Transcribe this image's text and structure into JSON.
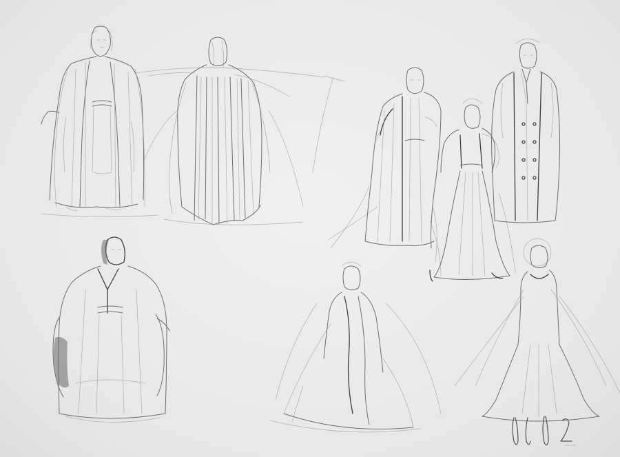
{
  "artwork": {
    "subject": "",
    "palette": {
      "paper": "#e9e9e9",
      "graphite": "#555555"
    }
  }
}
